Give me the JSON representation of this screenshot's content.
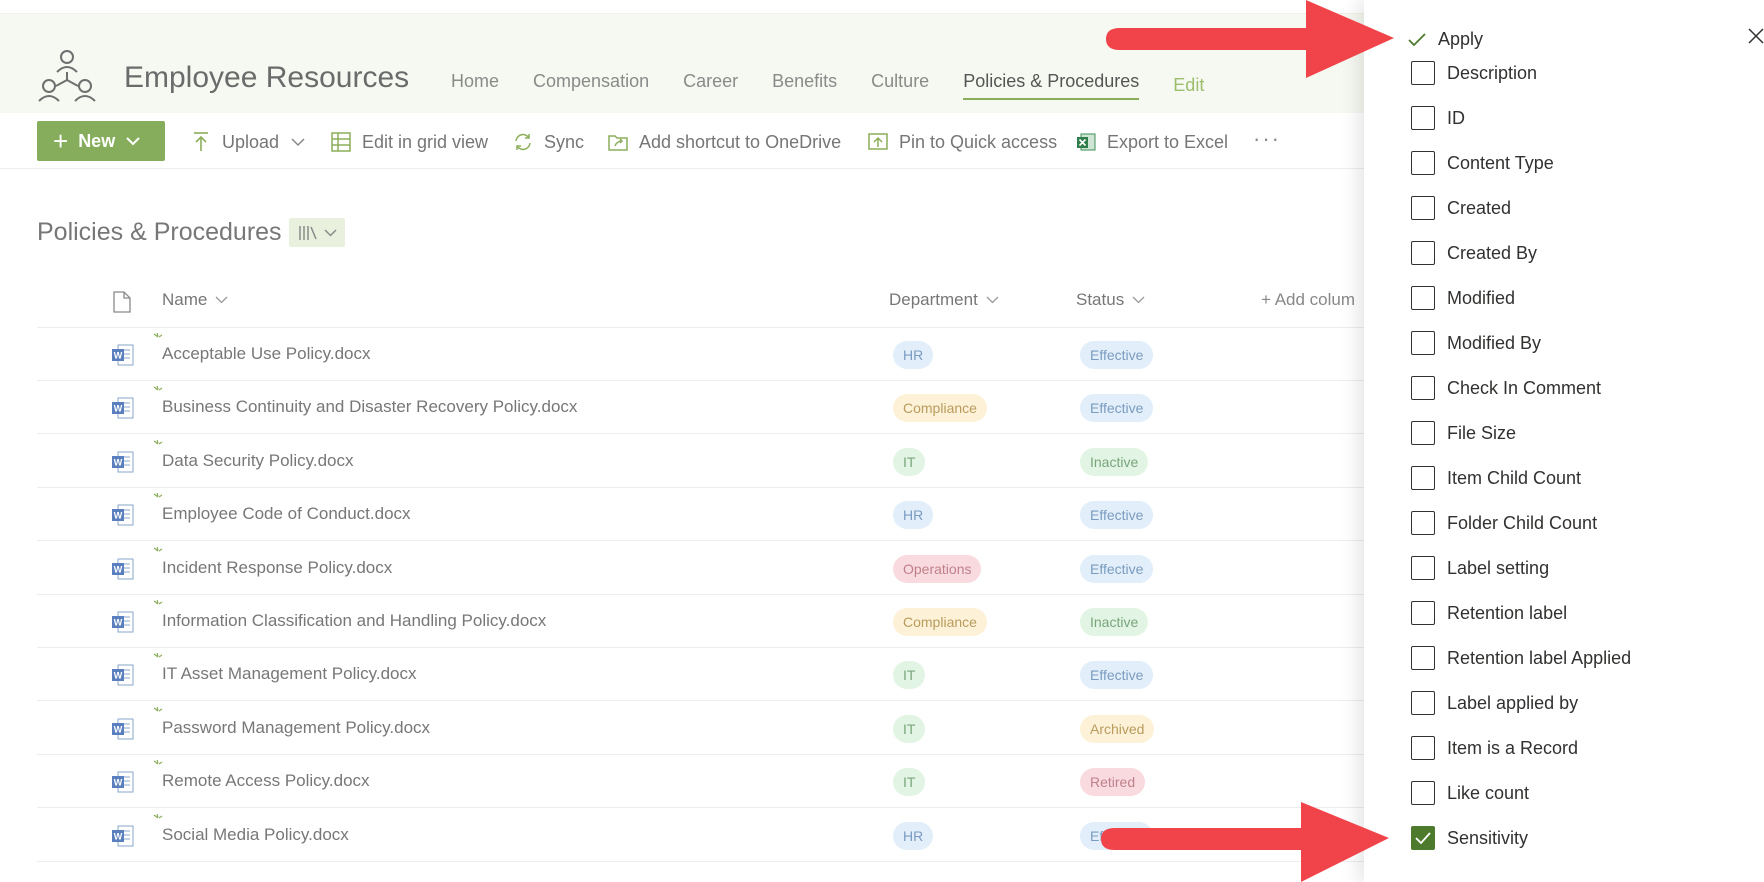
{
  "site": {
    "title": "Employee Resources",
    "nav": [
      "Home",
      "Compensation",
      "Career",
      "Benefits",
      "Culture",
      "Policies & Procedures"
    ],
    "edit_label": "Edit",
    "accent_color": "#86ad5b"
  },
  "toolbar": {
    "new_label": "New",
    "upload_label": "Upload",
    "grid_label": "Edit in grid view",
    "sync_label": "Sync",
    "shortcut_label": "Add shortcut to OneDrive",
    "pin_label": "Pin to Quick access",
    "export_label": "Export to Excel",
    "more_label": "···"
  },
  "library": {
    "title": "Policies & Procedures",
    "columns": {
      "name": "Name",
      "department": "Department",
      "status": "Status",
      "add_column": "+ Add colum"
    },
    "rows": [
      {
        "name": "Acceptable Use Policy.docx",
        "department": "HR",
        "status": "Effective"
      },
      {
        "name": "Business Continuity and Disaster Recovery Policy.docx",
        "department": "Compliance",
        "status": "Effective"
      },
      {
        "name": "Data Security Policy.docx",
        "department": "IT",
        "status": "Inactive"
      },
      {
        "name": "Employee Code of Conduct.docx",
        "department": "HR",
        "status": "Effective"
      },
      {
        "name": "Incident Response Policy.docx",
        "department": "Operations",
        "status": "Effective"
      },
      {
        "name": "Information Classification and Handling Policy.docx",
        "department": "Compliance",
        "status": "Inactive"
      },
      {
        "name": "IT Asset Management Policy.docx",
        "department": "IT",
        "status": "Effective"
      },
      {
        "name": "Password Management Policy.docx",
        "department": "IT",
        "status": "Archived"
      },
      {
        "name": "Remote Access Policy.docx",
        "department": "IT",
        "status": "Retired"
      },
      {
        "name": "Social Media Policy.docx",
        "department": "HR",
        "status": "Effective"
      }
    ]
  },
  "panel": {
    "apply_label": "Apply",
    "options": [
      {
        "label": "Description",
        "checked": false
      },
      {
        "label": "ID",
        "checked": false
      },
      {
        "label": "Content Type",
        "checked": false
      },
      {
        "label": "Created",
        "checked": false
      },
      {
        "label": "Created By",
        "checked": false
      },
      {
        "label": "Modified",
        "checked": false
      },
      {
        "label": "Modified By",
        "checked": false
      },
      {
        "label": "Check In Comment",
        "checked": false
      },
      {
        "label": "File Size",
        "checked": false
      },
      {
        "label": "Item Child Count",
        "checked": false
      },
      {
        "label": "Folder Child Count",
        "checked": false
      },
      {
        "label": "Label setting",
        "checked": false
      },
      {
        "label": "Retention label",
        "checked": false
      },
      {
        "label": "Retention label Applied",
        "checked": false
      },
      {
        "label": "Label applied by",
        "checked": false
      },
      {
        "label": "Item is a Record",
        "checked": false
      },
      {
        "label": "Like count",
        "checked": false
      },
      {
        "label": "Sensitivity",
        "checked": true
      }
    ]
  }
}
